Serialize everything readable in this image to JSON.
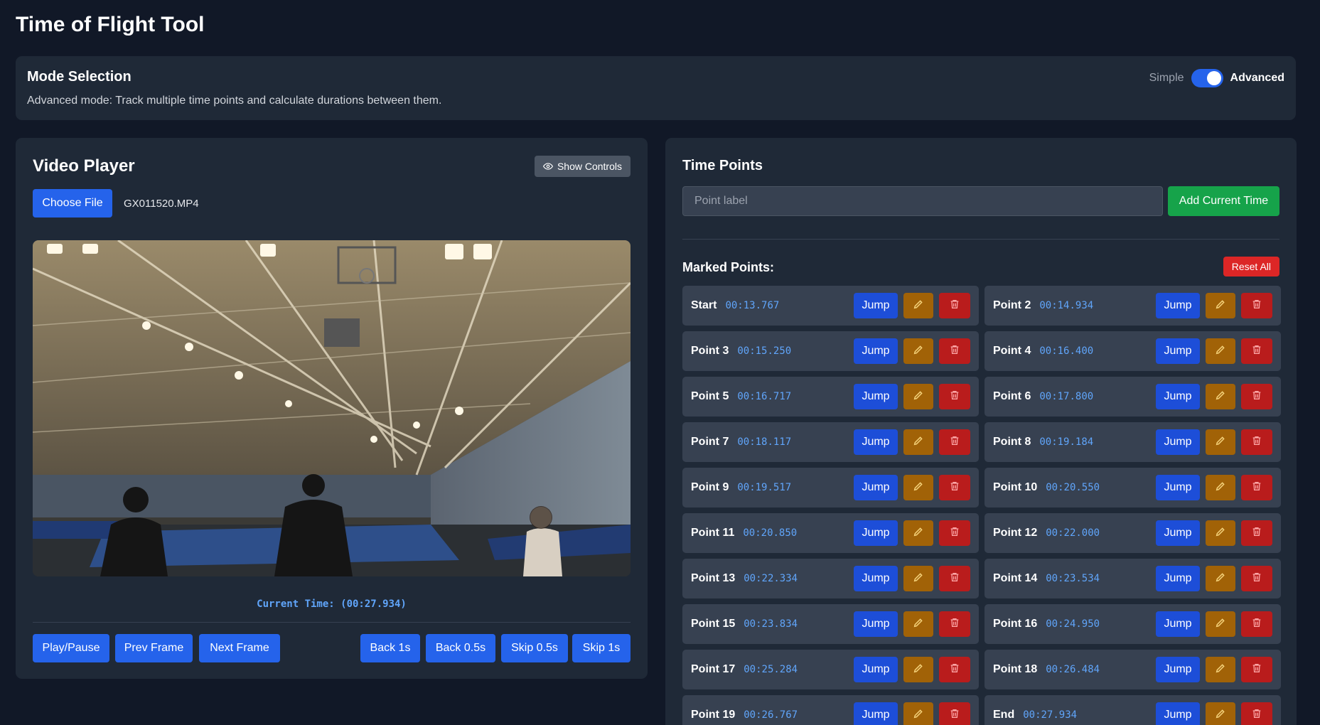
{
  "app": {
    "title": "Time of Flight Tool"
  },
  "mode": {
    "title": "Mode Selection",
    "description": "Advanced mode: Track multiple time points and calculate durations between them.",
    "simple_label": "Simple",
    "advanced_label": "Advanced",
    "selected": "Advanced"
  },
  "video": {
    "title": "Video Player",
    "show_controls_label": "Show Controls",
    "choose_file_label": "Choose File",
    "file_name": "GX011520.MP4",
    "current_time_text": "Current Time: (00:27.934)",
    "buttons": {
      "play_pause": "Play/Pause",
      "prev_frame": "Prev Frame",
      "next_frame": "Next Frame",
      "back_1s": "Back 1s",
      "back_05s": "Back 0.5s",
      "skip_05s": "Skip 0.5s",
      "skip_1s": "Skip 1s"
    }
  },
  "time_points": {
    "title": "Time Points",
    "label_placeholder": "Point label",
    "add_button": "Add Current Time",
    "marked_label": "Marked Points:",
    "reset_label": "Reset All",
    "jump_label": "Jump",
    "points": [
      {
        "name": "Start",
        "time": "00:13.767"
      },
      {
        "name": "Point 2",
        "time": "00:14.934"
      },
      {
        "name": "Point 3",
        "time": "00:15.250"
      },
      {
        "name": "Point 4",
        "time": "00:16.400"
      },
      {
        "name": "Point 5",
        "time": "00:16.717"
      },
      {
        "name": "Point 6",
        "time": "00:17.800"
      },
      {
        "name": "Point 7",
        "time": "00:18.117"
      },
      {
        "name": "Point 8",
        "time": "00:19.184"
      },
      {
        "name": "Point 9",
        "time": "00:19.517"
      },
      {
        "name": "Point 10",
        "time": "00:20.550"
      },
      {
        "name": "Point 11",
        "time": "00:20.850"
      },
      {
        "name": "Point 12",
        "time": "00:22.000"
      },
      {
        "name": "Point 13",
        "time": "00:22.334"
      },
      {
        "name": "Point 14",
        "time": "00:23.534"
      },
      {
        "name": "Point 15",
        "time": "00:23.834"
      },
      {
        "name": "Point 16",
        "time": "00:24.950"
      },
      {
        "name": "Point 17",
        "time": "00:25.284"
      },
      {
        "name": "Point 18",
        "time": "00:26.484"
      },
      {
        "name": "Point 19",
        "time": "00:26.767"
      },
      {
        "name": "End",
        "time": "00:27.934"
      }
    ]
  },
  "colors": {
    "background": "#111827",
    "panel": "#1f2937",
    "primary": "#2563eb",
    "success": "#16a34a",
    "danger": "#dc2626",
    "edit": "#a16207",
    "time_text": "#60a5fa"
  }
}
